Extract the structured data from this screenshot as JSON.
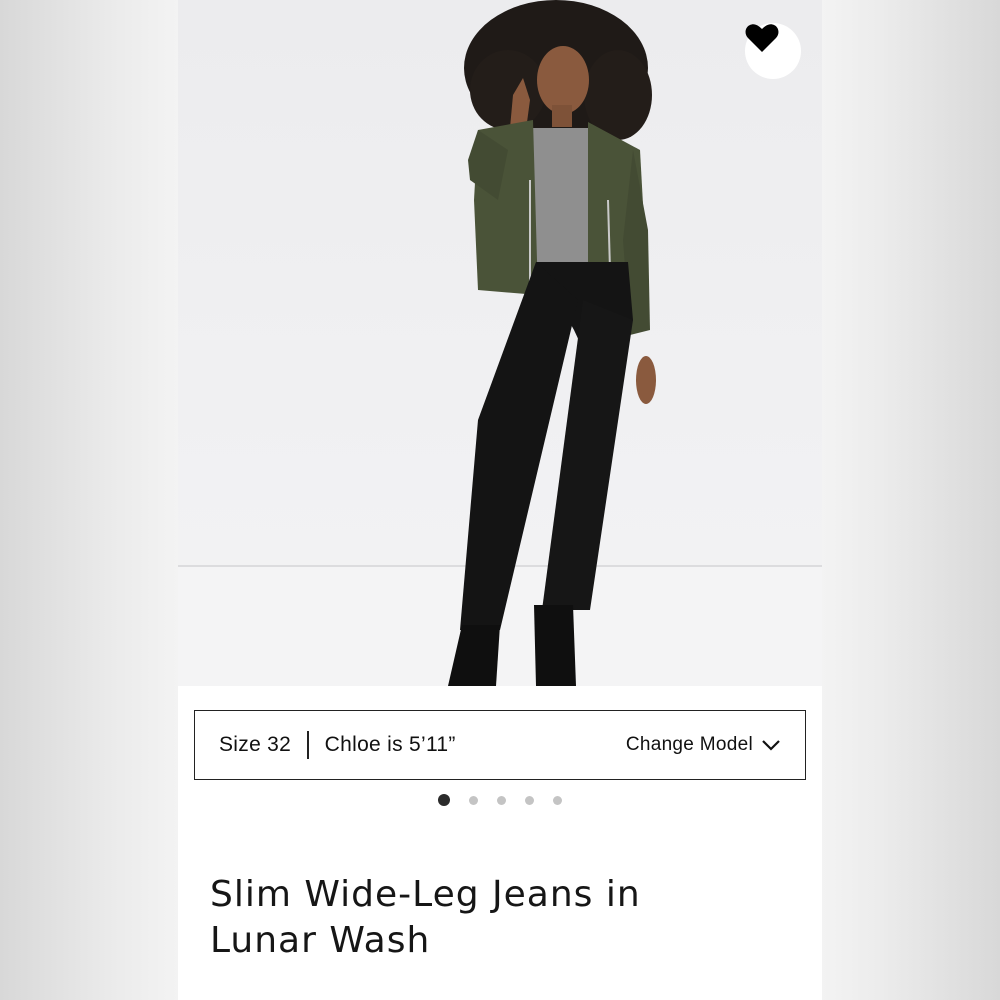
{
  "favorite": {
    "icon": "heart-icon",
    "active": true
  },
  "size_info": {
    "size": "Size 32",
    "model": "Chloe is 5’11”",
    "change_model_label": "Change Model",
    "chevron_icon": "chevron-down-icon"
  },
  "carousel": {
    "total": 5,
    "active_index": 0
  },
  "product": {
    "title_line1": "Slim Wide-Leg Jeans in",
    "title_line2": "Lunar Wash"
  },
  "colors": {
    "jacket": "#4a5338",
    "jeans": "#141414",
    "background": "#ffffff"
  }
}
